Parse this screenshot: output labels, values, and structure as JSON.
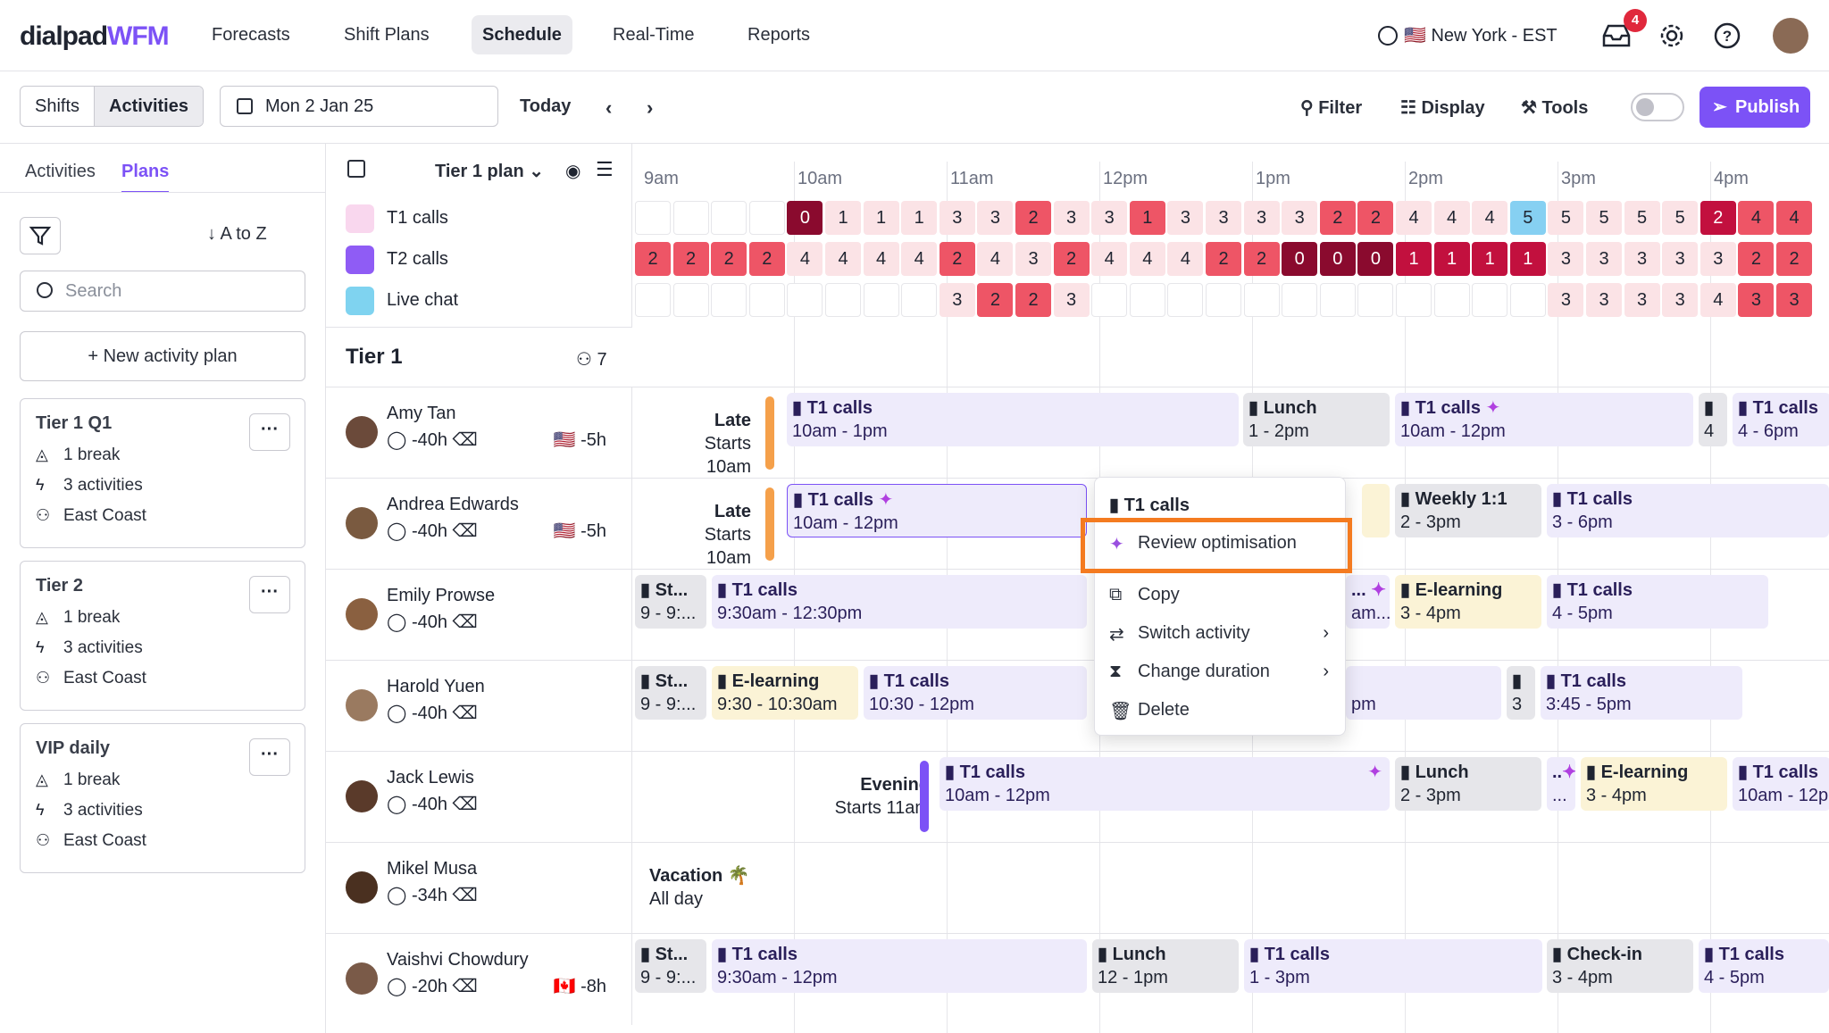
{
  "nav": {
    "logo_left": "dialpad",
    "logo_right": "WFM",
    "tabs": [
      "Forecasts",
      "Shift Plans",
      "Schedule",
      "Real-Time",
      "Reports"
    ],
    "timezone": "New York - EST",
    "inbox_badge": "4"
  },
  "toolbar": {
    "view_shifts": "Shifts",
    "view_activities": "Activities",
    "date": "Mon 2 Jan 25",
    "today": "Today",
    "filter": "Filter",
    "display": "Display",
    "tools": "Tools",
    "publish": "Publish"
  },
  "sidebar": {
    "tab_activities": "Activities",
    "tab_plans": "Plans",
    "sort": "A to Z",
    "search_placeholder": "Search",
    "new_plan": "New activity plan",
    "plans": [
      {
        "name": "Tier 1 Q1",
        "breaks": "1 break",
        "activities": "3 activities",
        "region": "East Coast"
      },
      {
        "name": "Tier 2",
        "breaks": "1 break",
        "activities": "3 activities",
        "region": "East Coast"
      },
      {
        "name": "VIP daily",
        "breaks": "1 break",
        "activities": "3 activities",
        "region": "East Coast"
      }
    ]
  },
  "grid": {
    "plan_selector": "Tier 1 plan",
    "activities": [
      {
        "name": "T1 calls",
        "color": "#f9d7ee"
      },
      {
        "name": "T2 calls",
        "color": "#8f5cf5"
      },
      {
        "name": "Live chat",
        "color": "#7fd3f0"
      }
    ],
    "hours": [
      "9am",
      "10am",
      "11am",
      "12pm",
      "1pm",
      "2pm",
      "3pm",
      "4pm"
    ],
    "coverage": [
      [
        "",
        "",
        "",
        "",
        "0",
        "1",
        "1",
        "1",
        "3",
        "3",
        "2",
        "3",
        "3",
        "1",
        "3",
        "3",
        "3",
        "3",
        "2",
        "2",
        "4",
        "4",
        "4",
        "5",
        "5",
        "5",
        "5",
        "5",
        "2",
        "4",
        "4"
      ],
      [
        "2",
        "2",
        "2",
        "2",
        "4",
        "4",
        "4",
        "4",
        "2",
        "4",
        "3",
        "2",
        "4",
        "4",
        "4",
        "2",
        "2",
        "0",
        "0",
        "0",
        "1",
        "1",
        "1",
        "1",
        "3",
        "3",
        "3",
        "3",
        "3",
        "2",
        "2"
      ],
      [
        "",
        "",
        "",
        "",
        "",
        "",
        "",
        "",
        "3",
        "2",
        "2",
        "3",
        "",
        "",
        "",
        "",
        "",
        "",
        "",
        "",
        "",
        "",
        "",
        "",
        "3",
        "3",
        "3",
        "3",
        "4",
        "3",
        "3"
      ]
    ],
    "group_name": "Tier 1",
    "group_count": "7",
    "employees": [
      {
        "name": "Amy Tan",
        "hours": "-40h",
        "offset": "-5h",
        "flag": "🇺🇸"
      },
      {
        "name": "Andrea Edwards",
        "hours": "-40h",
        "offset": "-5h",
        "flag": "🇺🇸"
      },
      {
        "name": "Emily Prowse",
        "hours": "-40h",
        "offset": "",
        "flag": ""
      },
      {
        "name": "Harold Yuen",
        "hours": "-40h",
        "offset": "",
        "flag": ""
      },
      {
        "name": "Jack Lewis",
        "hours": "-40h",
        "offset": "",
        "flag": ""
      },
      {
        "name": "Mikel Musa",
        "hours": "-34h",
        "offset": "",
        "flag": ""
      },
      {
        "name": "Vaishvi Chowdury",
        "hours": "-20h",
        "offset": "-8h",
        "flag": "🇨🇦"
      }
    ],
    "shift_labels": {
      "late": "Late",
      "late_start": "Starts 10am",
      "evening": "Evening",
      "evening_start": "Starts 11am",
      "vacation": "Vacation",
      "all_day": "All day"
    },
    "blocks": {
      "t1": "T1 calls",
      "t1_short": "T1 calls",
      "lunch": "Lunch",
      "weekly": "Weekly 1:1",
      "elearning": "E-learning",
      "checkin": "Check-in",
      "st": "St...",
      "st_time": "9 - 9:...",
      "t_10_1": "10am - 1pm",
      "t_1_2": "1 - 2pm",
      "t_10_12": "10am - 12pm",
      "t_4": "4",
      "t_4_6": "4 - 6pm",
      "t_2_3": "2 - 3pm",
      "t_3_6": "3 - 6pm",
      "t_930_1230": "9:30am - 12:30pm",
      "t_am": "am...",
      "t_3_4": "3 - 4pm",
      "t_4_5": "4 - 5pm",
      "t_930_1030": "9:30 - 10:30am",
      "t_1030_12": "10:30 - 12pm",
      "t_pm": "pm",
      "t_3": "3",
      "t_345_5": "3:45 - 5pm",
      "t_dots": "...",
      "t_10_12p": "10am - 12p",
      "t_930_12": "9:30am - 12pm",
      "t_12_1": "12 - 1pm",
      "t_1_3": "1 - 3pm",
      "t_ellip": "..."
    }
  },
  "context_menu": {
    "title": "T1 calls",
    "items": [
      "Review optimisation",
      "Copy",
      "Switch activity",
      "Change duration",
      "Delete"
    ]
  }
}
